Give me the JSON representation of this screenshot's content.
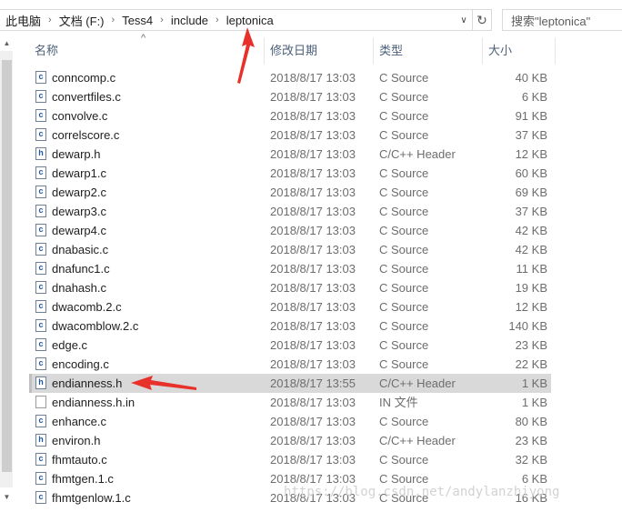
{
  "address": {
    "crumbs": [
      "此电脑",
      "文档 (F:)",
      "Tess4",
      "include",
      "leptonica"
    ],
    "separator": "›",
    "dropdown_glyph": "∨",
    "refresh_glyph": "↻"
  },
  "search": {
    "placeholder": "搜索\"leptonica\""
  },
  "columns": {
    "name": "名称",
    "date": "修改日期",
    "type": "类型",
    "size": "大小"
  },
  "icons": {
    "c_file": "c",
    "h_file": "h"
  },
  "files": [
    {
      "icon": "c",
      "name": "conncomp.c",
      "date": "2018/8/17 13:03",
      "type": "C Source",
      "size": "40 KB",
      "selected": false
    },
    {
      "icon": "c",
      "name": "convertfiles.c",
      "date": "2018/8/17 13:03",
      "type": "C Source",
      "size": "6 KB",
      "selected": false
    },
    {
      "icon": "c",
      "name": "convolve.c",
      "date": "2018/8/17 13:03",
      "type": "C Source",
      "size": "91 KB",
      "selected": false
    },
    {
      "icon": "c",
      "name": "correlscore.c",
      "date": "2018/8/17 13:03",
      "type": "C Source",
      "size": "37 KB",
      "selected": false
    },
    {
      "icon": "h",
      "name": "dewarp.h",
      "date": "2018/8/17 13:03",
      "type": "C/C++ Header",
      "size": "12 KB",
      "selected": false
    },
    {
      "icon": "c",
      "name": "dewarp1.c",
      "date": "2018/8/17 13:03",
      "type": "C Source",
      "size": "60 KB",
      "selected": false
    },
    {
      "icon": "c",
      "name": "dewarp2.c",
      "date": "2018/8/17 13:03",
      "type": "C Source",
      "size": "69 KB",
      "selected": false
    },
    {
      "icon": "c",
      "name": "dewarp3.c",
      "date": "2018/8/17 13:03",
      "type": "C Source",
      "size": "37 KB",
      "selected": false
    },
    {
      "icon": "c",
      "name": "dewarp4.c",
      "date": "2018/8/17 13:03",
      "type": "C Source",
      "size": "42 KB",
      "selected": false
    },
    {
      "icon": "c",
      "name": "dnabasic.c",
      "date": "2018/8/17 13:03",
      "type": "C Source",
      "size": "42 KB",
      "selected": false
    },
    {
      "icon": "c",
      "name": "dnafunc1.c",
      "date": "2018/8/17 13:03",
      "type": "C Source",
      "size": "11 KB",
      "selected": false
    },
    {
      "icon": "c",
      "name": "dnahash.c",
      "date": "2018/8/17 13:03",
      "type": "C Source",
      "size": "19 KB",
      "selected": false
    },
    {
      "icon": "c",
      "name": "dwacomb.2.c",
      "date": "2018/8/17 13:03",
      "type": "C Source",
      "size": "12 KB",
      "selected": false
    },
    {
      "icon": "c",
      "name": "dwacomblow.2.c",
      "date": "2018/8/17 13:03",
      "type": "C Source",
      "size": "140 KB",
      "selected": false
    },
    {
      "icon": "c",
      "name": "edge.c",
      "date": "2018/8/17 13:03",
      "type": "C Source",
      "size": "23 KB",
      "selected": false
    },
    {
      "icon": "c",
      "name": "encoding.c",
      "date": "2018/8/17 13:03",
      "type": "C Source",
      "size": "22 KB",
      "selected": false
    },
    {
      "icon": "h",
      "name": "endianness.h",
      "date": "2018/8/17 13:55",
      "type": "C/C++ Header",
      "size": "1 KB",
      "selected": true
    },
    {
      "icon": "blank",
      "name": "endianness.h.in",
      "date": "2018/8/17 13:03",
      "type": "IN 文件",
      "size": "1 KB",
      "selected": false
    },
    {
      "icon": "c",
      "name": "enhance.c",
      "date": "2018/8/17 13:03",
      "type": "C Source",
      "size": "80 KB",
      "selected": false
    },
    {
      "icon": "h",
      "name": "environ.h",
      "date": "2018/8/17 13:03",
      "type": "C/C++ Header",
      "size": "23 KB",
      "selected": false
    },
    {
      "icon": "c",
      "name": "fhmtauto.c",
      "date": "2018/8/17 13:03",
      "type": "C Source",
      "size": "32 KB",
      "selected": false
    },
    {
      "icon": "c",
      "name": "fhmtgen.1.c",
      "date": "2018/8/17 13:03",
      "type": "C Source",
      "size": "6 KB",
      "selected": false
    },
    {
      "icon": "c",
      "name": "fhmtgenlow.1.c",
      "date": "2018/8/17 13:03",
      "type": "C Source",
      "size": "16 KB",
      "selected": false
    }
  ],
  "colors": {
    "annotation_arrow": "#e8312b",
    "selection": "#d9d9d9"
  },
  "watermark": "https://blog.csdn.net/andylanzhiyong"
}
